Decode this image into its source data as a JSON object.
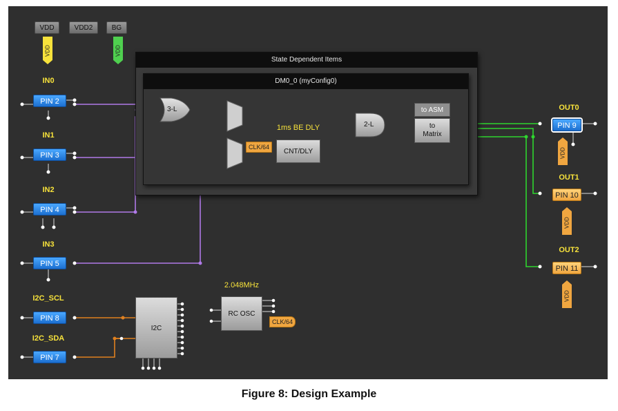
{
  "supplies": {
    "vdd": "VDD",
    "vdd2": "VDD2",
    "bg": "BG"
  },
  "inputs": [
    {
      "label": "IN0",
      "pin": "PIN 2"
    },
    {
      "label": "IN1",
      "pin": "PIN 3"
    },
    {
      "label": "IN2",
      "pin": "PIN 4"
    },
    {
      "label": "IN3",
      "pin": "PIN 5"
    },
    {
      "label": "I2C_SCL",
      "pin": "PIN 8"
    },
    {
      "label": "I2C_SDA",
      "pin": "PIN 7"
    }
  ],
  "outputs": [
    {
      "label": "OUT0",
      "pin": "PIN 9"
    },
    {
      "label": "OUT1",
      "pin": "PIN 10"
    },
    {
      "label": "OUT2",
      "pin": "PIN 11"
    }
  ],
  "vdd_tag": "VDD",
  "state_panel": {
    "title": "State Dependent Items",
    "dm_title": "DM0_0 (myConfig0)"
  },
  "blocks": {
    "gate3": "3-L",
    "gate2": "2-L",
    "cnt_dly": "CNT/DLY",
    "delay_label": "1ms BE DLY",
    "clk_tag": "CLK/64",
    "to_asm": "to ASM",
    "to_matrix": "to Matrix",
    "i2c": "I2C",
    "rc_osc": "RC OSC",
    "osc_freq": "2.048MHz",
    "osc_clk": "CLK/64"
  },
  "caption": "Figure 8: Design Example",
  "colors": {
    "canvas": "#2f2f2f",
    "purple_wire": "#b07ae8",
    "orange_wire": "#e0801f",
    "green_wire": "#2fd62f",
    "pin_blue": "#2a86e8",
    "pin_amber": "#f5b955",
    "tag_yellow": "#f7e23b"
  }
}
